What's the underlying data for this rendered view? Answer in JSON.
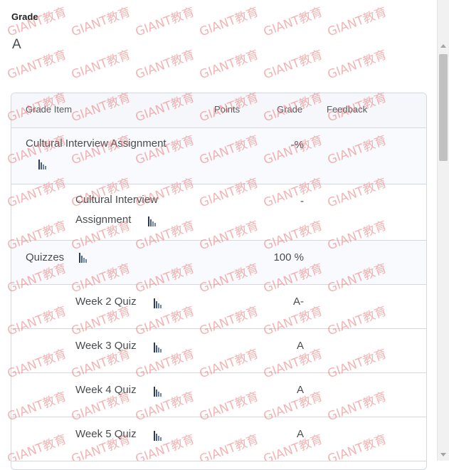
{
  "overall": {
    "label": "Grade",
    "value": "A"
  },
  "table": {
    "headers": {
      "item": "Grade Item",
      "points": "Points",
      "grade": "Grade",
      "feedback": "Feedback"
    },
    "rows": [
      {
        "name": "Cultural Interview Assignment",
        "grade": "-%",
        "level": "category"
      },
      {
        "name_line1": "Cultural Interview",
        "name_line2": "Assignment",
        "grade": "-",
        "level": "item"
      },
      {
        "name": "Quizzes",
        "grade": "100 %",
        "level": "category"
      },
      {
        "name": "Week 2 Quiz",
        "grade": "A-",
        "level": "item"
      },
      {
        "name": "Week 3 Quiz",
        "grade": "A",
        "level": "item"
      },
      {
        "name": "Week 4 Quiz",
        "grade": "A",
        "level": "item"
      },
      {
        "name": "Week 5 Quiz",
        "grade": "A",
        "level": "item"
      }
    ]
  },
  "icons": {
    "stats": "bar-chart-icon"
  },
  "watermark_text": "GIANT教育",
  "colors": {
    "text": "#494c4e",
    "border": "#d3d9e3",
    "shaded_row": "#f9fafd",
    "icon_dark": "#2b3a55",
    "icon_light": "#6f86a8",
    "watermark": "#e67878"
  }
}
